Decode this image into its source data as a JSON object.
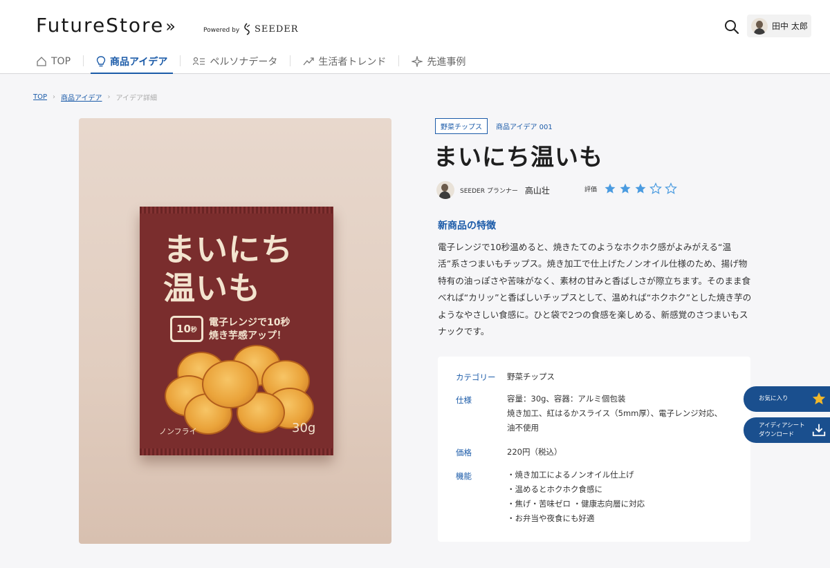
{
  "header": {
    "logo_text": "FutureStore",
    "logo_arrows": "»",
    "powered_by": "Powered by",
    "seeder_brand": "SEEDER",
    "user_name": "田中 太郎"
  },
  "nav": [
    {
      "label": "TOP",
      "icon": "home-icon"
    },
    {
      "label": "商品アイデア",
      "icon": "lightbulb-icon",
      "active": true
    },
    {
      "label": "ペルソナデータ",
      "icon": "persona-list-icon"
    },
    {
      "label": "生活者トレンド",
      "icon": "trend-icon"
    },
    {
      "label": "先進事例",
      "icon": "sparkle-icon"
    }
  ],
  "breadcrumb": {
    "items": [
      "TOP",
      "商品アイデア"
    ],
    "current": "アイデア詳細"
  },
  "product_image": {
    "bag_title_line1": "まいにち",
    "bag_title_line2": "温いも",
    "badge_number": "10",
    "badge_unit": "秒",
    "bag_subtitle_line1": "電子レンジで10秒",
    "bag_subtitle_line2": "焼き芋感アップ！",
    "bag_nonfry": "ノンフライ",
    "bag_weight": "30g"
  },
  "product": {
    "category_tag": "野菜チップス",
    "idea_id": "商品アイデア 001",
    "title": "まいにち温いも",
    "planner_role": "SEEDER プランナー",
    "planner_name": "高山壮",
    "rating_label": "評価",
    "rating_value": 3,
    "rating_max": 5,
    "features_heading": "新商品の特徴",
    "description": "電子レンジで10秒温めると、焼きたてのようなホクホク感がよみがえる“温活”系さつまいもチップス。焼き加工で仕上げたノンオイル仕様のため、揚げ物特有の油っぽさや苦味がなく、素材の甘みと香ばしさが際立ちます。そのまま食べれば“カリッ”と香ばしいチップスとして、温めれば“ホクホク”とした焼き芋のようなやさしい食感に。ひと袋で2つの食感を楽しめる、新感覚のさつまいもスナックです。"
  },
  "specs": {
    "category_label": "カテゴリー",
    "category_value": "野菜チップス",
    "spec_label": "仕様",
    "spec_lines": [
      "容量：30g、容器：アルミ個包装",
      "焼き加工、紅はるかスライス（5mm厚）、電子レンジ対応、",
      "油不使用"
    ],
    "price_label": "価格",
    "price_value": "220円（税込）",
    "function_label": "機能",
    "function_lines": [
      "・焼き加工によるノンオイル仕上げ",
      "・温めるとホクホク食感に",
      "・焦げ・苦味ゼロ ・健康志向層に対応",
      "・お弁当や夜食にも好適"
    ]
  },
  "side_buttons": {
    "favorite_label": "お気に入り",
    "download_label_line1": "アイディアシート",
    "download_label_line2": "ダウンロード"
  },
  "colors": {
    "accent": "#1a5aa8",
    "side_button": "#1a4f8e",
    "star_filled": "#4a9be0",
    "star_gold": "#f2b82a",
    "bag": "#7a2d2d"
  }
}
